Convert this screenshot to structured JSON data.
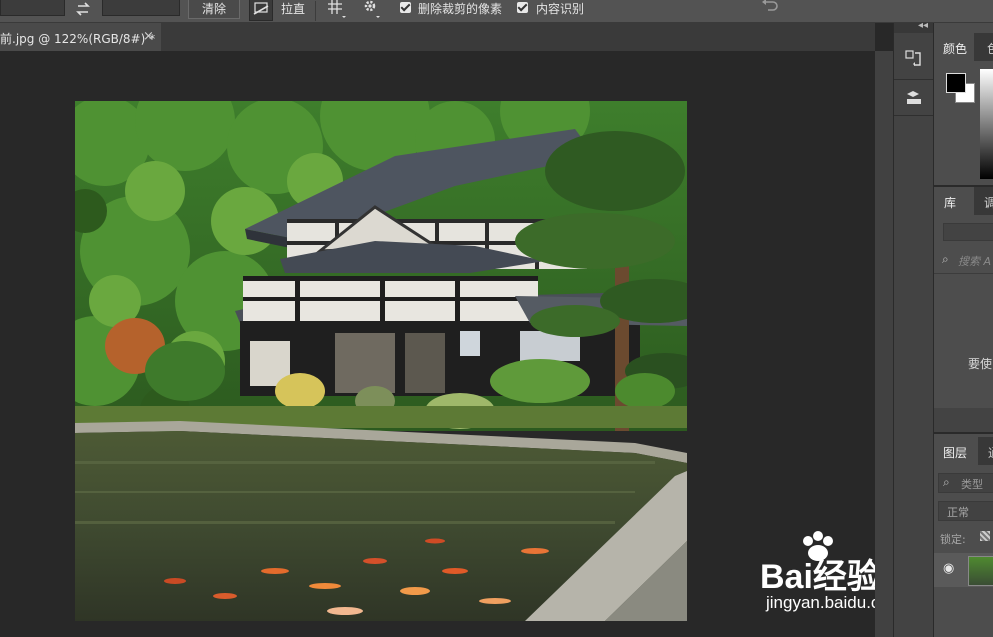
{
  "options_bar": {
    "clear_button": "清除",
    "straighten_label": "拉直",
    "delete_cropped_label": "删除裁剪的像素",
    "content_aware_label": "内容识别"
  },
  "document_tab": {
    "title": "前.jpg @ 122%(RGB/8#) *",
    "close": "×"
  },
  "panels": {
    "color_tab": "颜色",
    "swatches_tab_partial": "色",
    "library_tab": "库",
    "adjust_tab_partial": "调",
    "library_search_placeholder": "搜索 A",
    "library_message_partial": "要使",
    "layers_tab": "图层",
    "channels_tab_partial": "通",
    "layer_filter": "类型",
    "blend_mode": "正常",
    "lock_label": "锁定:"
  },
  "watermark": {
    "logo_text": "Bai经验",
    "url": "jingyan.baidu.com"
  },
  "colors": {
    "ui_bg": "#535353",
    "canvas_bg": "#282828",
    "panel_bg": "#4d4d4d"
  }
}
